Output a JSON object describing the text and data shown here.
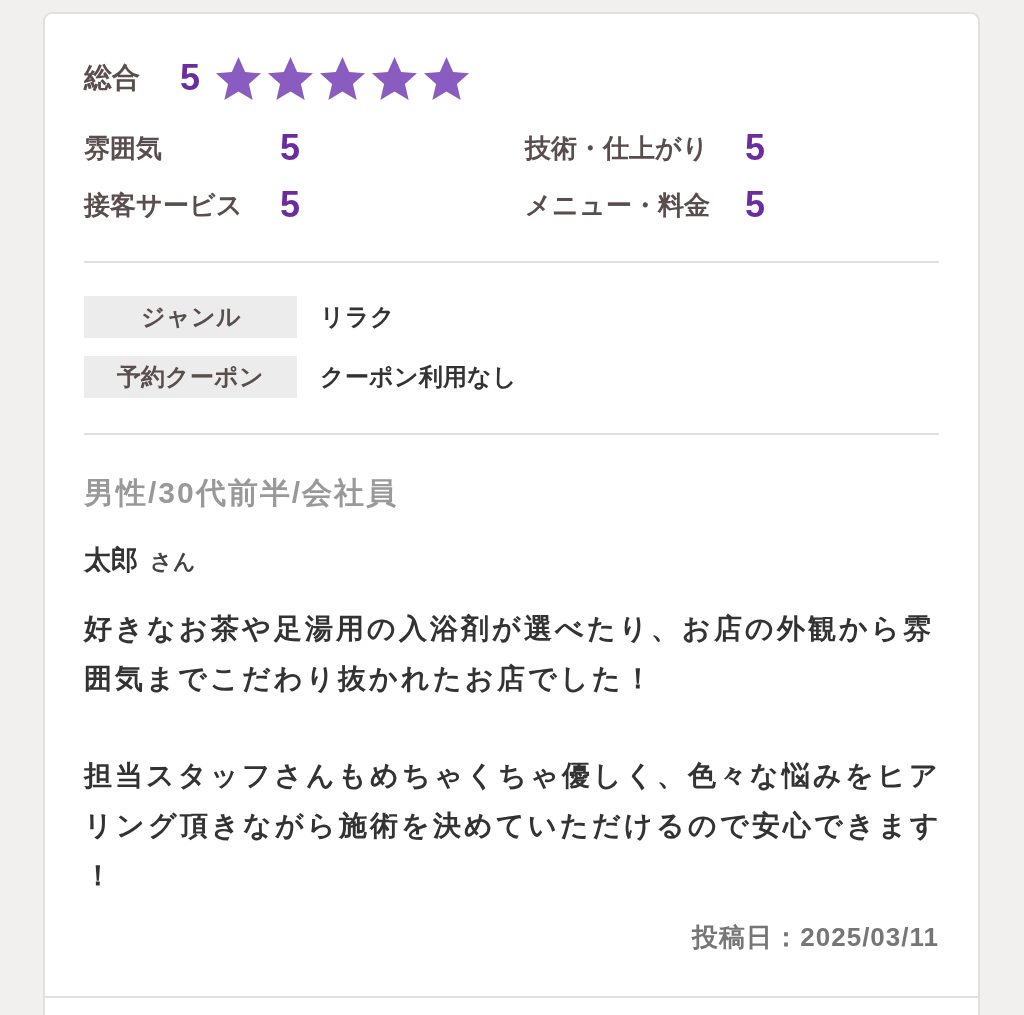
{
  "overall": {
    "label": "総合",
    "score": "5",
    "stars": 5
  },
  "ratings": [
    {
      "label": "雰囲気",
      "score": "5"
    },
    {
      "label": "技術・仕上がり",
      "score": "5"
    },
    {
      "label": "接客サービス",
      "score": "5"
    },
    {
      "label": "メニュー・料金",
      "score": "5"
    }
  ],
  "details": [
    {
      "label": "ジャンル",
      "value": "リラク"
    },
    {
      "label": "予約クーポン",
      "value": "クーポン利用なし"
    }
  ],
  "reviewer": {
    "profile": "男性/30代前半/会社員",
    "name": "太郎",
    "honorific": "さん"
  },
  "comment": [
    "好きなお茶や足湯用の入浴剤が選べたり、お店の外観から雰囲気までこだわり抜かれたお店でした！",
    "担当スタッフさんもめちゃくちゃ優しく、色々な悩みをヒアリング頂きながら施術を決めていただけるので安心できます！"
  ],
  "posted": "投稿日：2025/03/11"
}
